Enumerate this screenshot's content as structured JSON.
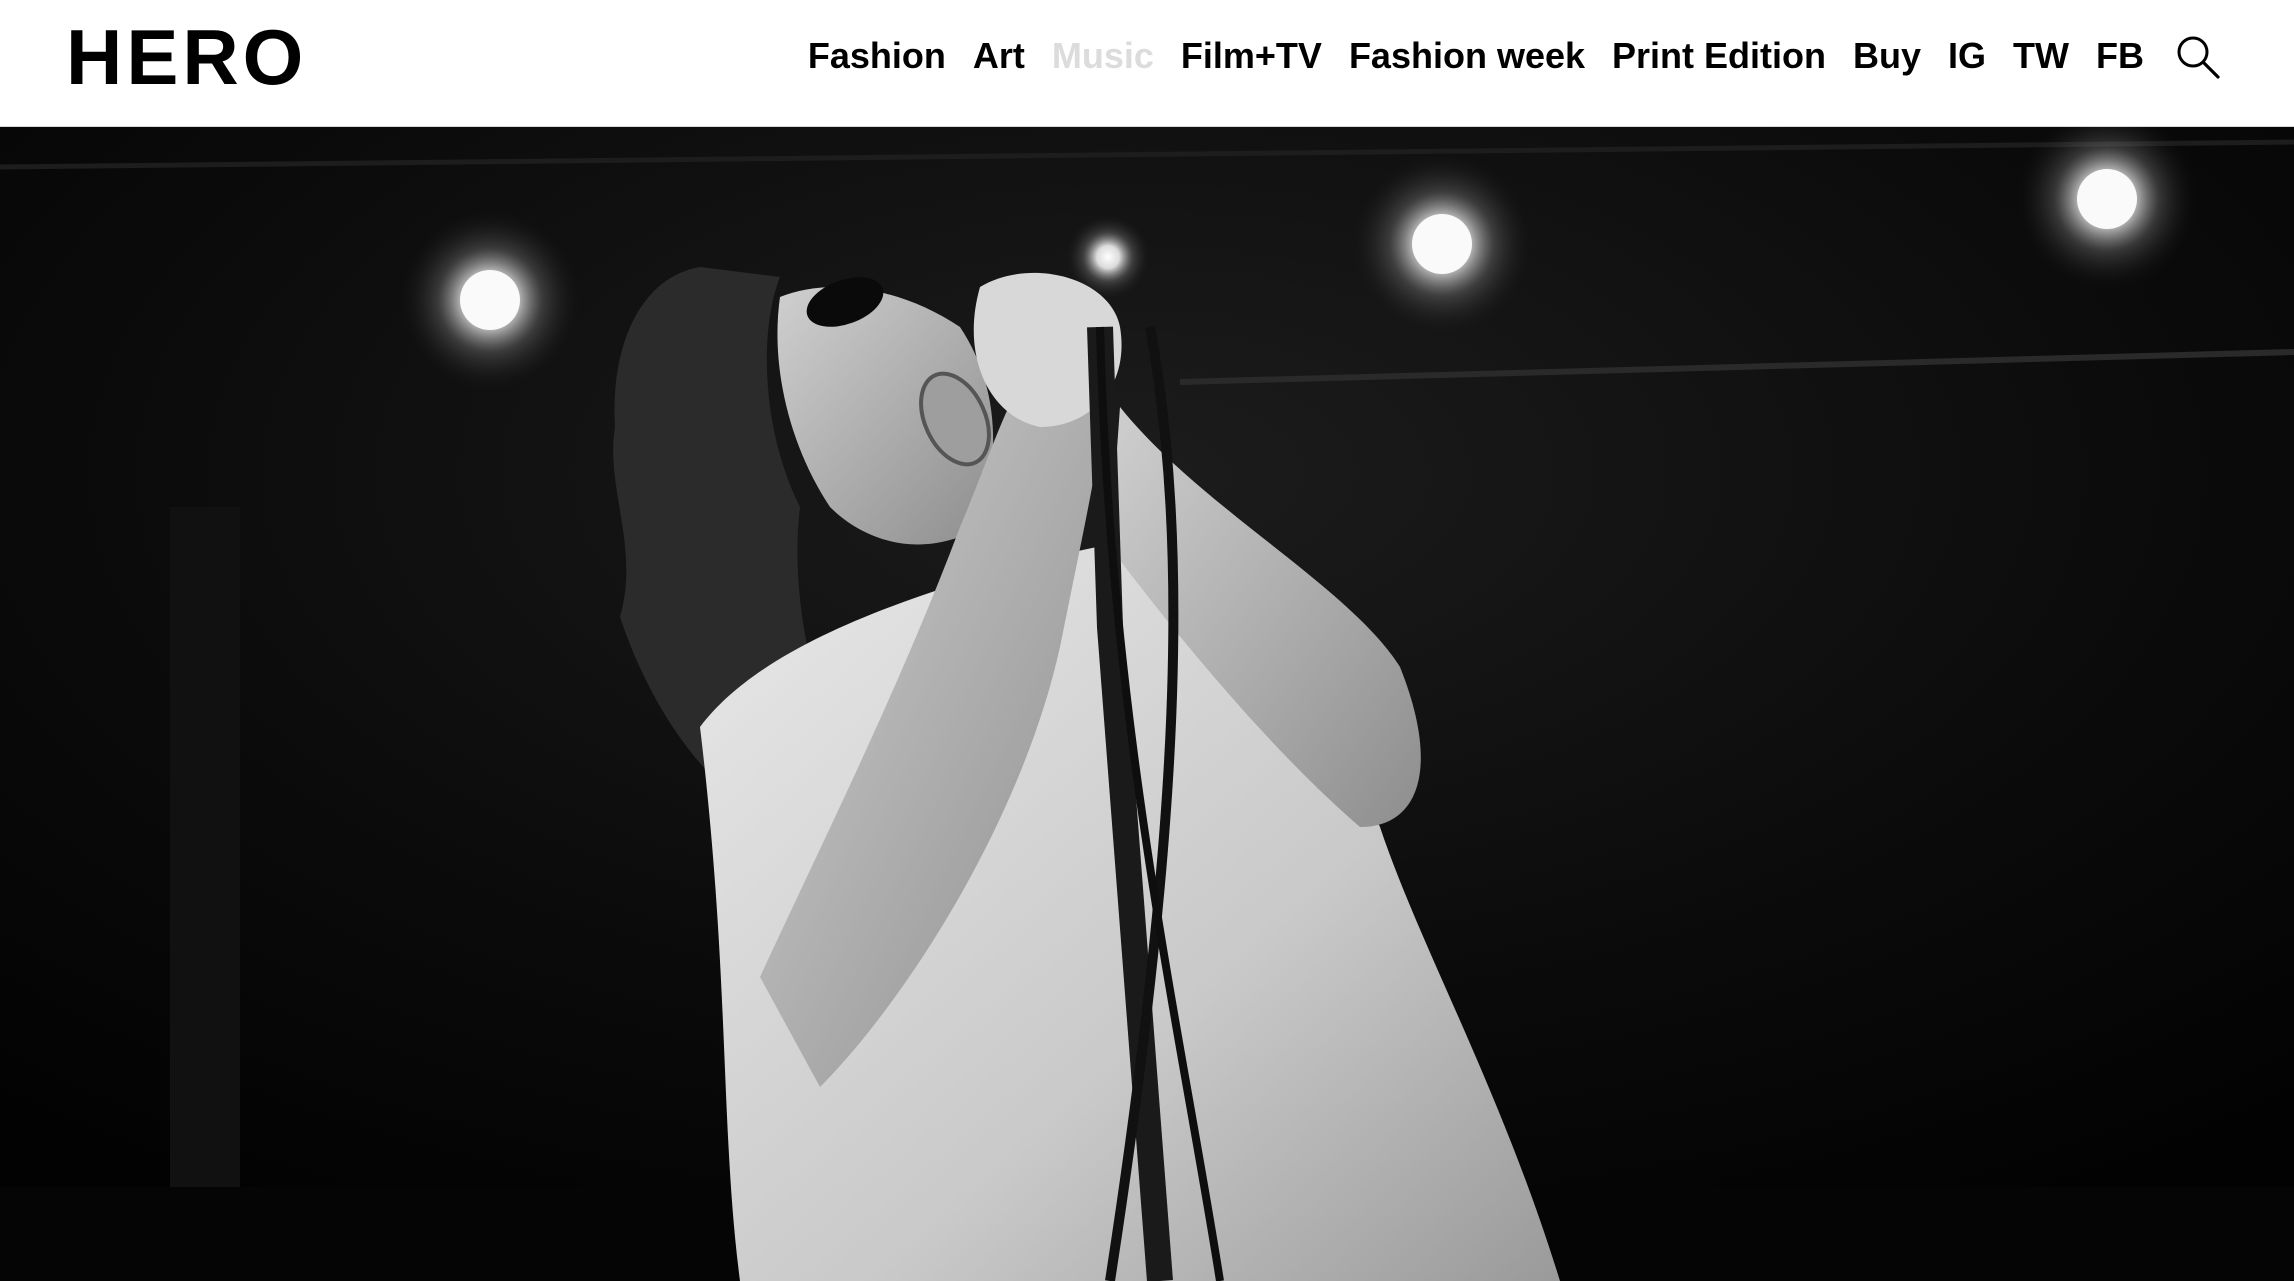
{
  "site": {
    "logo": "HERO"
  },
  "nav": {
    "items": [
      {
        "label": "Fashion",
        "active": false
      },
      {
        "label": "Art",
        "active": false
      },
      {
        "label": "Music",
        "active": true
      },
      {
        "label": "Film+TV",
        "active": false
      },
      {
        "label": "Fashion week",
        "active": false
      },
      {
        "label": "Print Edition",
        "active": false
      },
      {
        "label": "Buy",
        "active": false
      },
      {
        "label": "IG",
        "active": false
      },
      {
        "label": "TW",
        "active": false
      },
      {
        "label": "FB",
        "active": false
      }
    ]
  },
  "search": {
    "icon": "search-icon"
  },
  "colors": {
    "header_bg": "#ffffff",
    "nav_text": "#000000",
    "nav_active": "#dcdcdc",
    "photo_bg": "#070707"
  }
}
